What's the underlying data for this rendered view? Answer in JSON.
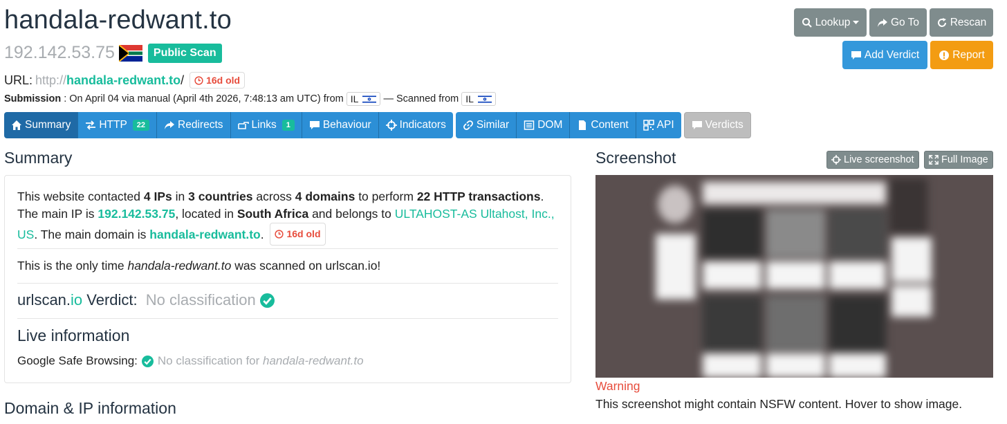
{
  "header": {
    "domain": "handala-redwant.to",
    "ip": "192.142.53.75",
    "public_scan_label": "Public Scan"
  },
  "url_row": {
    "label": "URL:",
    "proto": "http://",
    "host": "handala-redwant.to",
    "path": "/",
    "age": "16d old"
  },
  "submission": {
    "label": "Submission",
    "text": ": On April 04 via manual (April 4th 2026, 7:48:13 am UTC) from",
    "from_cc": "IL",
    "scanned_from_text": "— Scanned from",
    "scanned_cc": "IL"
  },
  "actions": {
    "lookup": "Lookup",
    "goto": "Go To",
    "rescan": "Rescan",
    "add_verdict": "Add Verdict",
    "report": "Report"
  },
  "tabs": [
    {
      "label": "Summary",
      "icon": "home-icon",
      "active": true
    },
    {
      "label": "HTTP",
      "icon": "exchange-icon",
      "count": "22"
    },
    {
      "label": "Redirects",
      "icon": "share-icon"
    },
    {
      "label": "Links",
      "icon": "hand-point-icon",
      "count": "1"
    },
    {
      "label": "Behaviour",
      "icon": "comment-icon"
    },
    {
      "label": "Indicators",
      "icon": "crosshairs-icon"
    },
    {
      "label": "Similar",
      "icon": "link-icon"
    },
    {
      "label": "DOM",
      "icon": "list-alt-icon"
    },
    {
      "label": "Content",
      "icon": "file-icon"
    },
    {
      "label": "API",
      "icon": "qrcode-icon"
    },
    {
      "label": "Verdicts",
      "icon": "comment-icon",
      "disabled": true
    }
  ],
  "summary": {
    "title": "Summary",
    "p1": {
      "t1": "This website contacted ",
      "ips": "4 IPs",
      "t2": " in ",
      "countries": "3 countries",
      "t3": " across ",
      "domains": "4 domains",
      "t4": " to perform ",
      "transactions": "22 HTTP transactions",
      "t5": ". The main IP is ",
      "main_ip": "192.142.53.75",
      "t6": ", located in ",
      "country": "South Africa",
      "t7": " and belongs to ",
      "asn": "ULTAHOST-AS Ultahost, Inc., US",
      "t8": ". The main domain is ",
      "main_domain": "handala-redwant.to",
      "t9": ".",
      "age": "16d old"
    },
    "p2": {
      "t1": "This is the only time ",
      "domain": "handala-redwant.to",
      "t2": " was scanned on urlscan.io!"
    },
    "verdict": {
      "brand_a": "urlscan.",
      "brand_b": "io",
      "label": " Verdict: ",
      "value": "No classification"
    },
    "live": {
      "title": "Live information",
      "gsb_label": "Google Safe Browsing:",
      "gsb_value": "No classification for ",
      "gsb_domain": "handala-redwant.to"
    }
  },
  "domain_ip_title": "Domain & IP information",
  "screenshot": {
    "title": "Screenshot",
    "live_btn": "Live screenshot",
    "full_btn": "Full Image",
    "warning_title": "Warning",
    "warning_text": "This screenshot might contain NSFW content. Hover to show image."
  },
  "colors": {
    "accent": "#18bc9c",
    "tab_blue": "#2c8fd6",
    "danger": "#e74c3c",
    "warning": "#f39c12"
  }
}
